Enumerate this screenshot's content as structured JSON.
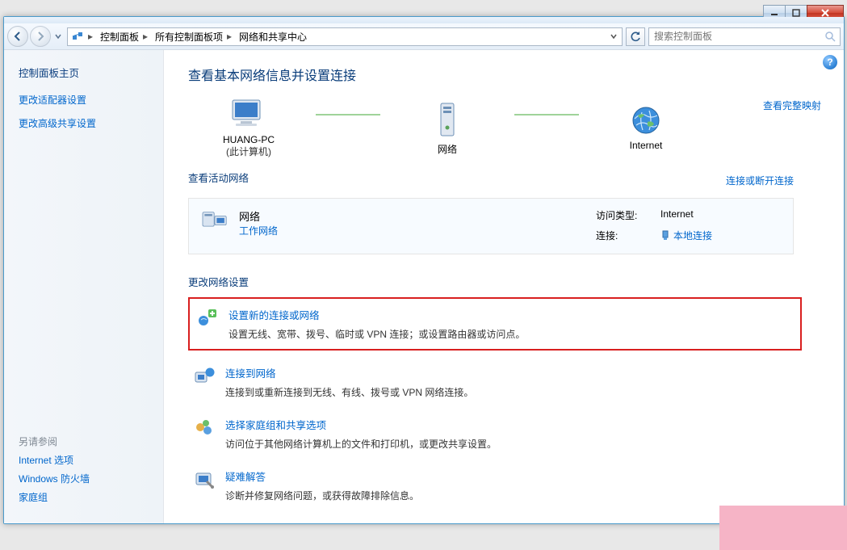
{
  "window_buttons": {
    "minimize": "minimize",
    "maximize": "maximize",
    "close": "close"
  },
  "breadcrumbs": [
    "控制面板",
    "所有控制面板项",
    "网络和共享中心"
  ],
  "search_placeholder": "搜索控制面板",
  "sidebar": {
    "home": "控制面板主页",
    "links": [
      "更改适配器设置",
      "更改高级共享设置"
    ],
    "see_also_title": "另请参阅",
    "see_also": [
      "Internet 选项",
      "Windows 防火墙",
      "家庭组"
    ]
  },
  "content": {
    "title": "查看基本网络信息并设置连接",
    "map_full_link": "查看完整映射",
    "map": {
      "node1": "HUANG-PC",
      "node1_sub": "(此计算机)",
      "node2": "网络",
      "node3": "Internet"
    },
    "active_hdr": "查看活动网络",
    "active_hdr_right": "连接或断开连接",
    "active": {
      "name": "网络",
      "type_link": "工作网络",
      "access_label": "访问类型:",
      "access_value": "Internet",
      "conn_label": "连接:",
      "conn_value": "本地连接"
    },
    "change_hdr": "更改网络设置",
    "tasks": [
      {
        "title": "设置新的连接或网络",
        "desc": "设置无线、宽带、拨号、临时或 VPN 连接；或设置路由器或访问点。",
        "hilite": true
      },
      {
        "title": "连接到网络",
        "desc": "连接到或重新连接到无线、有线、拨号或 VPN 网络连接。",
        "hilite": false
      },
      {
        "title": "选择家庭组和共享选项",
        "desc": "访问位于其他网络计算机上的文件和打印机，或更改共享设置。",
        "hilite": false
      },
      {
        "title": "疑难解答",
        "desc": "诊断并修复网络问题，或获得故障排除信息。",
        "hilite": false
      }
    ]
  }
}
